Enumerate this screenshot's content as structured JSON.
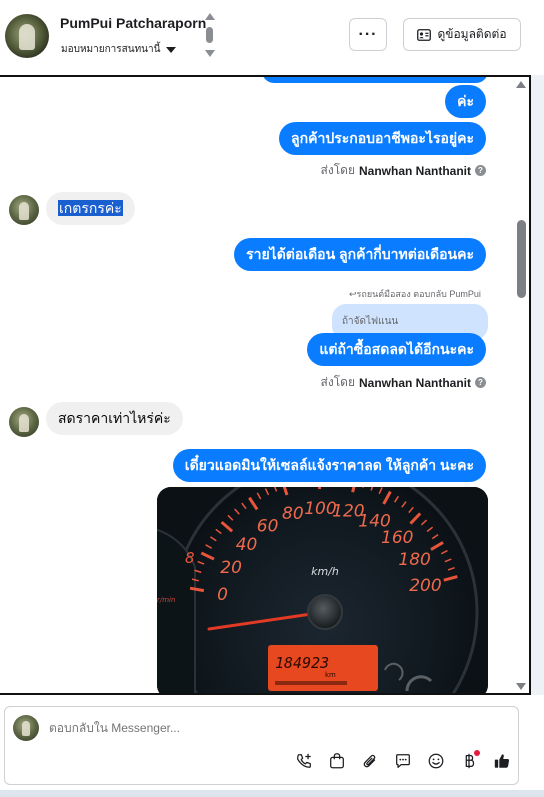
{
  "header": {
    "contact_name": "PumPui Patcharaporn",
    "assign_label": "มอบหมายการสนทนานี้",
    "more_label": "···",
    "view_contact_label": "ดูข้อมูลติดต่อ"
  },
  "messages": {
    "out_1": "ค่ะ",
    "out_2": "ลูกค้าประกอบอาชีพอะไรอยู่คะ",
    "sent_by_1": {
      "prefix": "ส่งโดย",
      "name": "Nanwhan Nanthanit"
    },
    "in_1": "เกตรกรค่ะ",
    "out_3": "รายได้ต่อเดือน ลูกค้ากี่บาทต่อเดือนคะ",
    "reply_label": "↩รถยนต์มือสอง ตอบกลับ PumPui",
    "quoted_text": "ถ้าจัดไฟแนน",
    "out_4": "แต่ถ้าซื้อสดลดได้อีกนะคะ",
    "sent_by_2": {
      "prefix": "ส่งโดย",
      "name": "Nanwhan Nanthanit"
    },
    "in_2": "สดราคาเท่าไหร่ค่ะ",
    "out_5": "เดี๋ยวแอดมินให้เซลล์แจ้งราคาลด ให้ลูกค้า นะคะ"
  },
  "photo": {
    "icon": "speedometer-photo",
    "speed_labels": [
      "0",
      "20",
      "40",
      "60",
      "80",
      "100",
      "120",
      "140",
      "160",
      "180",
      "200"
    ],
    "unit": "km/h",
    "odometer": "184923",
    "odometer_unit": "km",
    "tacho_digit": "8",
    "tacho_unit": "r/min"
  },
  "composer": {
    "placeholder": "ตอบกลับใน Messenger..."
  },
  "icons": {
    "tools": [
      "call-add-icon",
      "shopping-bag-icon",
      "attachment-icon",
      "saved-reply-icon",
      "emoji-icon",
      "baht-payment-icon",
      "like-icon"
    ]
  },
  "colors": {
    "accent": "#0a7cff",
    "incoming": "#f0f0f0",
    "notification_dot": "#e41e3f"
  }
}
